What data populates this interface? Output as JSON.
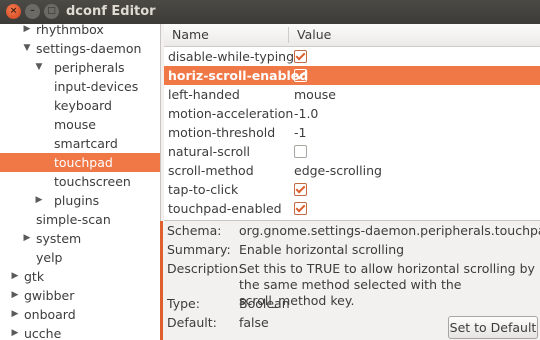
{
  "window": {
    "title": "dconf Editor",
    "close_glyph": "×",
    "min_glyph": "–",
    "max_glyph": "□"
  },
  "tree": [
    {
      "label": "rhythmbox",
      "arrow": "▶",
      "level": 1,
      "selected": false
    },
    {
      "label": "settings-daemon",
      "arrow": "▼",
      "level": 1,
      "selected": false
    },
    {
      "label": "peripherals",
      "arrow": "▼",
      "level": 2,
      "selected": false
    },
    {
      "label": "input-devices",
      "arrow": "",
      "level": 3,
      "selected": false
    },
    {
      "label": "keyboard",
      "arrow": "",
      "level": 3,
      "selected": false
    },
    {
      "label": "mouse",
      "arrow": "",
      "level": 3,
      "selected": false
    },
    {
      "label": "smartcard",
      "arrow": "",
      "level": 3,
      "selected": false
    },
    {
      "label": "touchpad",
      "arrow": "",
      "level": 3,
      "selected": true
    },
    {
      "label": "touchscreen",
      "arrow": "",
      "level": 3,
      "selected": false
    },
    {
      "label": "plugins",
      "arrow": "▶",
      "level": 2,
      "selected": false
    },
    {
      "label": "simple-scan",
      "arrow": "",
      "level": 1,
      "selected": false
    },
    {
      "label": "system",
      "arrow": "▶",
      "level": 1,
      "selected": false
    },
    {
      "label": "yelp",
      "arrow": "",
      "level": 1,
      "selected": false
    },
    {
      "label": "gtk",
      "arrow": "▶",
      "level": 0,
      "selected": false
    },
    {
      "label": "gwibber",
      "arrow": "▶",
      "level": 0,
      "selected": false
    },
    {
      "label": "onboard",
      "arrow": "▶",
      "level": 0,
      "selected": false
    },
    {
      "label": "ucche",
      "arrow": "▶",
      "level": 0,
      "selected": false
    }
  ],
  "grid": {
    "col_name": "Name",
    "col_value": "Value",
    "rows": [
      {
        "name": "disable-while-typing",
        "type": "bool",
        "checked": true,
        "value": "",
        "selected": false
      },
      {
        "name": "horiz-scroll-enabled",
        "type": "bool",
        "checked": true,
        "value": "",
        "selected": true
      },
      {
        "name": "left-handed",
        "type": "text",
        "checked": false,
        "value": "mouse",
        "selected": false
      },
      {
        "name": "motion-acceleration",
        "type": "text",
        "checked": false,
        "value": "-1.0",
        "selected": false
      },
      {
        "name": "motion-threshold",
        "type": "text",
        "checked": false,
        "value": "-1",
        "selected": false
      },
      {
        "name": "natural-scroll",
        "type": "bool",
        "checked": false,
        "value": "",
        "selected": false
      },
      {
        "name": "scroll-method",
        "type": "text",
        "checked": false,
        "value": "edge-scrolling",
        "selected": false
      },
      {
        "name": "tap-to-click",
        "type": "bool",
        "checked": true,
        "value": "",
        "selected": false
      },
      {
        "name": "touchpad-enabled",
        "type": "bool",
        "checked": true,
        "value": "",
        "selected": false
      }
    ]
  },
  "details": {
    "schema_label": "Schema:",
    "schema": "org.gnome.settings-daemon.peripherals.touchpad",
    "summary_label": "Summary:",
    "summary": "Enable horizontal scrolling",
    "description_label": "Description:",
    "description": "Set this to TRUE to allow horizontal scrolling by the same method selected with the scroll_method key.",
    "type_label": "Type:",
    "type": "Boolean",
    "default_label": "Default:",
    "default": "false"
  },
  "buttons": {
    "set_default": "Set to Default"
  },
  "colors": {
    "accent": "#f07746",
    "titlebar": "#3c3b37",
    "close": "#e05a28"
  }
}
